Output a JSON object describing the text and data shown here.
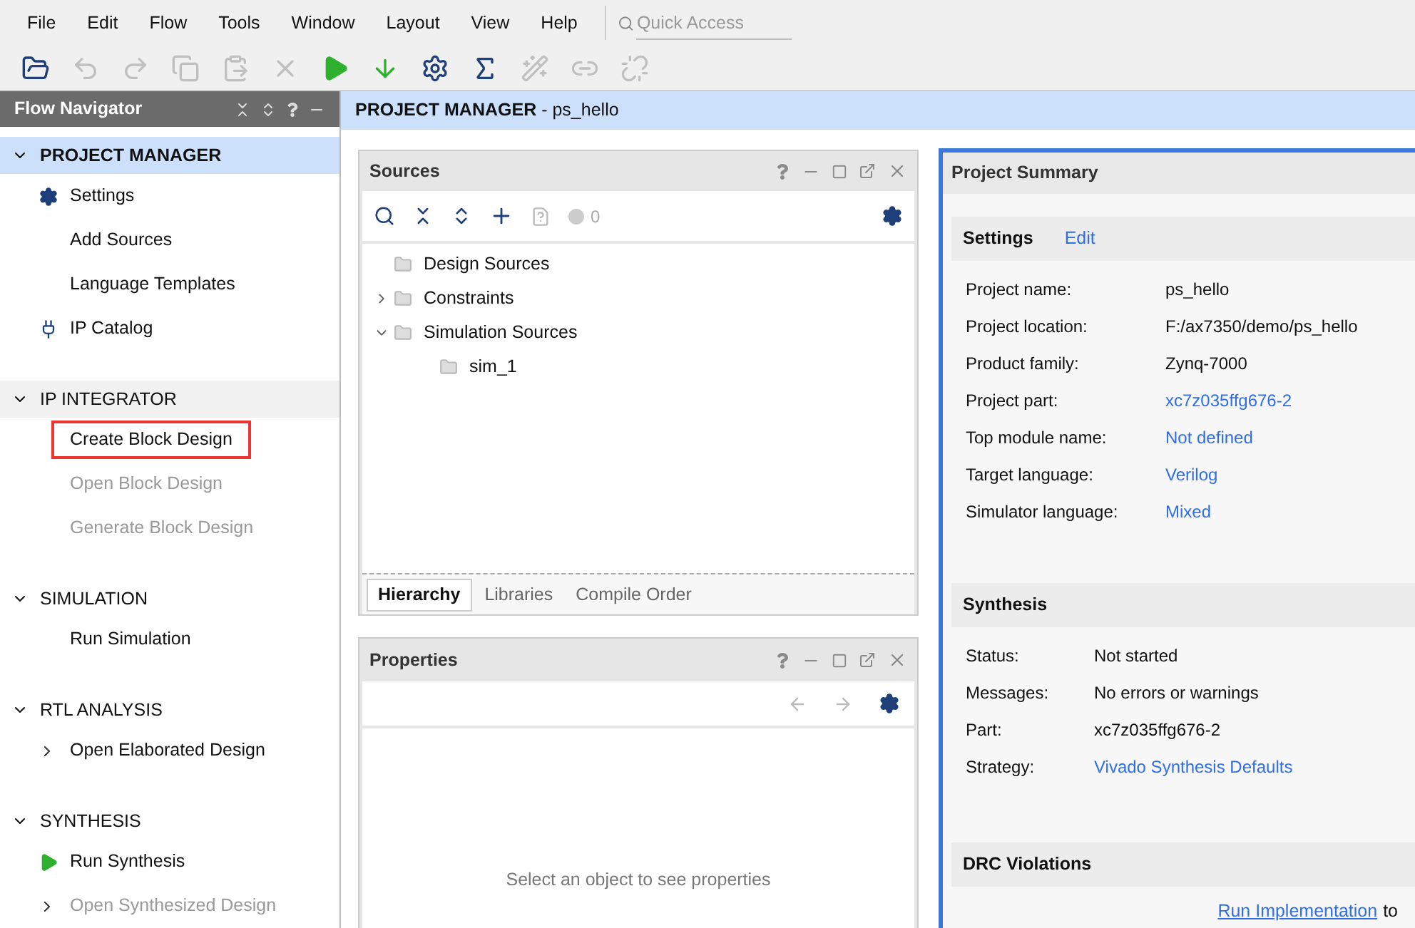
{
  "menu": [
    {
      "label": "File"
    },
    {
      "label": "Edit"
    },
    {
      "label": "Flow"
    },
    {
      "label": "Tools"
    },
    {
      "label": "Window"
    },
    {
      "label": "Layout"
    },
    {
      "label": "View"
    },
    {
      "label": "Help"
    }
  ],
  "quick_access": {
    "placeholder": "Quick Access"
  },
  "toolbar": [
    {
      "kind": "open",
      "disabled": false
    },
    {
      "kind": "undo",
      "disabled": true
    },
    {
      "kind": "redo",
      "disabled": true
    },
    {
      "kind": "copy",
      "disabled": true
    },
    {
      "kind": "paste",
      "disabled": true
    },
    {
      "kind": "delete",
      "disabled": true
    },
    {
      "kind": "run",
      "disabled": false
    },
    {
      "kind": "bitstream",
      "disabled": false
    },
    {
      "kind": "settings",
      "disabled": false
    },
    {
      "kind": "sigma",
      "disabled": false
    },
    {
      "kind": "wand",
      "disabled": true
    },
    {
      "kind": "link",
      "disabled": true
    },
    {
      "kind": "unlink",
      "disabled": true
    }
  ],
  "flow_navigator": {
    "title": "Flow Navigator",
    "sections": [
      {
        "label": "PROJECT MANAGER",
        "expanded": true,
        "selected": true,
        "hovered": false,
        "items": [
          {
            "label": "Settings",
            "kind": "gear",
            "disabled": false,
            "highlighted": false
          },
          {
            "label": "Add Sources",
            "kind": "plain",
            "disabled": false,
            "highlighted": false
          },
          {
            "label": "Language Templates",
            "kind": "plain",
            "disabled": false,
            "highlighted": false
          },
          {
            "label": "IP Catalog",
            "kind": "plug",
            "disabled": false,
            "highlighted": false
          }
        ]
      },
      {
        "label": "IP INTEGRATOR",
        "expanded": true,
        "selected": false,
        "hovered": true,
        "items": [
          {
            "label": "Create Block Design",
            "kind": "plain",
            "disabled": false,
            "highlighted": true
          },
          {
            "label": "Open Block Design",
            "kind": "plain",
            "disabled": true,
            "highlighted": false
          },
          {
            "label": "Generate Block Design",
            "kind": "plain",
            "disabled": true,
            "highlighted": false
          }
        ]
      },
      {
        "label": "SIMULATION",
        "expanded": true,
        "selected": false,
        "hovered": false,
        "items": [
          {
            "label": "Run Simulation",
            "kind": "plain",
            "disabled": false,
            "highlighted": false
          }
        ]
      },
      {
        "label": "RTL ANALYSIS",
        "expanded": true,
        "selected": false,
        "hovered": false,
        "items": [
          {
            "label": "Open Elaborated Design",
            "kind": "expandable",
            "disabled": false,
            "highlighted": false
          }
        ]
      },
      {
        "label": "SYNTHESIS",
        "expanded": true,
        "selected": false,
        "hovered": false,
        "items": [
          {
            "label": "Run Synthesis",
            "kind": "play",
            "disabled": false,
            "highlighted": false
          },
          {
            "label": "Open Synthesized Design",
            "kind": "expandable",
            "disabled": true,
            "highlighted": false
          }
        ]
      }
    ]
  },
  "header": {
    "title": "PROJECT MANAGER",
    "separator": "-",
    "project": "ps_hello"
  },
  "sources": {
    "title": "Sources",
    "message_count": "0",
    "tree": [
      {
        "label": "Design Sources"
      },
      {
        "label": "Constraints",
        "expanded": false
      },
      {
        "label": "Simulation Sources",
        "expanded": true,
        "children": [
          {
            "label": "sim_1"
          }
        ]
      }
    ],
    "tabs": [
      {
        "label": "Hierarchy",
        "selected": true
      },
      {
        "label": "Libraries",
        "selected": false
      },
      {
        "label": "Compile Order",
        "selected": false
      }
    ]
  },
  "properties": {
    "title": "Properties",
    "empty_message": "Select an object to see properties"
  },
  "project_summary": {
    "title": "Project Summary",
    "sections": [
      {
        "title": "Settings",
        "action": "Edit",
        "rows": [
          {
            "label": "Project name:",
            "value": "ps_hello",
            "link": false
          },
          {
            "label": "Project location:",
            "value": "F:/ax7350/demo/ps_hello",
            "link": false
          },
          {
            "label": "Product family:",
            "value": "Zynq-7000",
            "link": false
          },
          {
            "label": "Project part:",
            "value": "xc7z035ffg676-2",
            "link": true
          },
          {
            "label": "Top module name:",
            "value": "Not defined",
            "link": true
          },
          {
            "label": "Target language:",
            "value": "Verilog",
            "link": true
          },
          {
            "label": "Simulator language:",
            "value": "Mixed",
            "link": true
          }
        ]
      },
      {
        "title": "Synthesis",
        "rows": [
          {
            "label": "Status:",
            "value": "Not started",
            "link": false
          },
          {
            "label": "Messages:",
            "value": "No errors or warnings",
            "link": false
          },
          {
            "label": "Part:",
            "value": "xc7z035ffg676-2",
            "link": false
          },
          {
            "label": "Strategy:",
            "value": "Vivado Synthesis Defaults",
            "link": true
          }
        ]
      },
      {
        "title": "DRC Violations",
        "footer_link": "Run Implementation",
        "footer_text": "to"
      }
    ]
  }
}
